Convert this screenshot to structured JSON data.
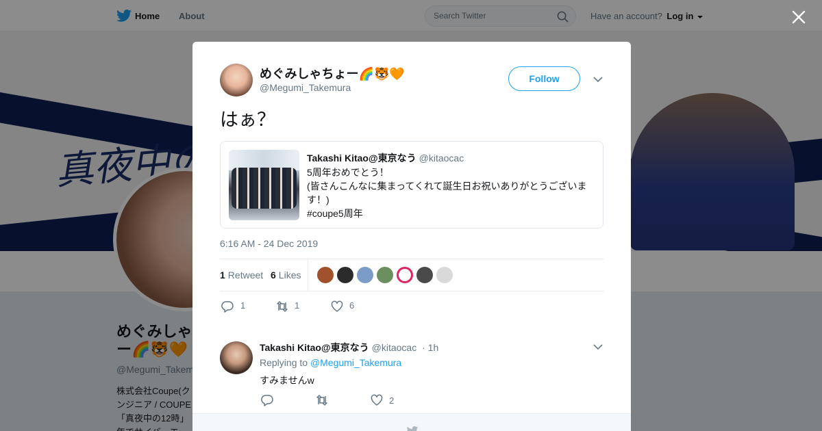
{
  "topbar": {
    "home_label": "Home",
    "about_label": "About",
    "search_placeholder": "Search Twitter",
    "account_prompt": "Have an account?",
    "login_label": "Log in"
  },
  "banner": {
    "text": "真夜中の"
  },
  "profile": {
    "name": "めぐみしゃ ー🌈🐯🧡",
    "handle": "@Megumi_Takem",
    "bio": "株式会社Coupe(ク ンジニア / COUPE 「真夜中の12時」 年でサイバーエー"
  },
  "modal": {
    "author": {
      "name": "めぐみしゃちょー🌈🐯🧡",
      "handle": "@Megumi_Takemura",
      "follow_label": "Follow"
    },
    "tweet_text": "はぁ？",
    "quote": {
      "author_name": "Takashi Kitao@東京なう",
      "author_handle": "@kitaocac",
      "line1": "5周年おめでとう！",
      "line2": "(皆さんこんなに集まってくれて誕生日お祝いありがとうございます！)",
      "line3": "#coupe5周年"
    },
    "timestamp": "6:16 AM - 24 Dec 2019",
    "stats": {
      "retweets_count": "1",
      "retweets_label": "Retweet",
      "likes_count": "6",
      "likes_label": "Likes"
    },
    "likers": [
      {
        "color": "#a0522d"
      },
      {
        "color": "#2b2b2b"
      },
      {
        "color": "#7a9cc6"
      },
      {
        "color": "#6b8f5e"
      },
      {
        "color": "#e0245e"
      },
      {
        "color": "#4a4a4a"
      },
      {
        "color": "#d9d9d9"
      }
    ],
    "actions": {
      "reply_count": "1",
      "retweet_count": "1",
      "like_count": "6"
    },
    "reply": {
      "author_name": "Takashi Kitao@東京なう",
      "author_handle": "@kitaocac",
      "time": "· 1h",
      "replying_prefix": "Replying to",
      "replying_to": "@Megumi_Takemura",
      "text": "すみませんw",
      "like_count": "2"
    }
  },
  "colors": {
    "accent": "#1da1f2",
    "muted": "#657786",
    "banner_navy": "#0d1f55"
  }
}
